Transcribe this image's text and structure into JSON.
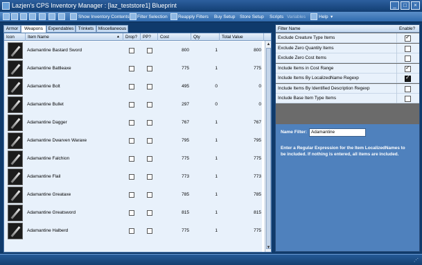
{
  "window": {
    "title": "Lazjen's CPS Inventory Manager : [laz_teststore1] Blueprint",
    "buttons": {
      "minimize": "_",
      "maximize": "□",
      "close": "×"
    }
  },
  "toolbar": {
    "show_inventory_contents": "Show Inventory Contents",
    "filter_selection": "Filter Selection",
    "reapply_filters": "Reapply Filters",
    "buy_setup": "Buy Setup",
    "store_setup": "Store Setup",
    "scripts": "Scripts",
    "variables": "Variables",
    "help": "Help",
    "help_arrow": "▾"
  },
  "tabs": [
    "Armor",
    "Weapons",
    "Expendables",
    "Trinkets",
    "Miscellaneous"
  ],
  "active_tab": "Weapons",
  "grid": {
    "columns": [
      "Icon",
      "Item Name",
      "Drop?",
      "PP?",
      "Cost",
      "Qty",
      "Total Value"
    ],
    "sort_glyph": "▲",
    "rows": [
      {
        "name": "Adamantine Bastard Sword",
        "drop": false,
        "pp": false,
        "cost": "800",
        "qty": "1",
        "total": "800"
      },
      {
        "name": "Adamantine Battleaxe",
        "drop": false,
        "pp": false,
        "cost": "775",
        "qty": "1",
        "total": "775"
      },
      {
        "name": "Adamantine Bolt",
        "drop": false,
        "pp": false,
        "cost": "495",
        "qty": "0",
        "total": "0"
      },
      {
        "name": "Adamantine Bullet",
        "drop": false,
        "pp": false,
        "cost": "297",
        "qty": "0",
        "total": "0"
      },
      {
        "name": "Adamantine Dagger",
        "drop": false,
        "pp": false,
        "cost": "767",
        "qty": "1",
        "total": "767"
      },
      {
        "name": "Adamantine Dwarven Waraxe",
        "drop": false,
        "pp": false,
        "cost": "795",
        "qty": "1",
        "total": "795"
      },
      {
        "name": "Adamantine Falchion",
        "drop": false,
        "pp": false,
        "cost": "775",
        "qty": "1",
        "total": "775"
      },
      {
        "name": "Adamantine Flail",
        "drop": false,
        "pp": false,
        "cost": "773",
        "qty": "1",
        "total": "773"
      },
      {
        "name": "Adamantine Greataxe",
        "drop": false,
        "pp": false,
        "cost": "785",
        "qty": "1",
        "total": "785"
      },
      {
        "name": "Adamantine Greatsword",
        "drop": false,
        "pp": false,
        "cost": "815",
        "qty": "1",
        "total": "815"
      },
      {
        "name": "Adamantine Halberd",
        "drop": false,
        "pp": false,
        "cost": "775",
        "qty": "1",
        "total": "775"
      },
      {
        "name": "",
        "drop": false,
        "pp": false,
        "cost": "",
        "qty": "",
        "total": ""
      }
    ]
  },
  "filters": {
    "columns": [
      "Filter Name",
      "Enable?"
    ],
    "rows": [
      {
        "name": "Exclude Creature Type Items",
        "enabled": true
      },
      {
        "name": "Exclude Zero Quantity Items",
        "enabled": false
      },
      {
        "name": "Exclude Zero Cost Items",
        "enabled": false
      },
      {
        "name": "Include Items in Cost Range",
        "enabled": true
      },
      {
        "name": "Include Items By LocalizedName Regexp",
        "enabled": true,
        "selected": true
      },
      {
        "name": "Include Items By Identified Description Regexp",
        "enabled": false
      },
      {
        "name": "Include Base Item Type Items",
        "enabled": false
      }
    ],
    "name_filter_label": "Name Filter:",
    "name_filter_value": "Adamantine",
    "help_text": "Enter a Regular Expression for the Item LocalizedNames to be included. If nothing is entered, all items are included."
  },
  "colors": {
    "window_bg": "#0f3a6b",
    "toolbar": "#3f77b8",
    "panel": "#4f81bd",
    "row_bg": "#e8f1fb"
  }
}
